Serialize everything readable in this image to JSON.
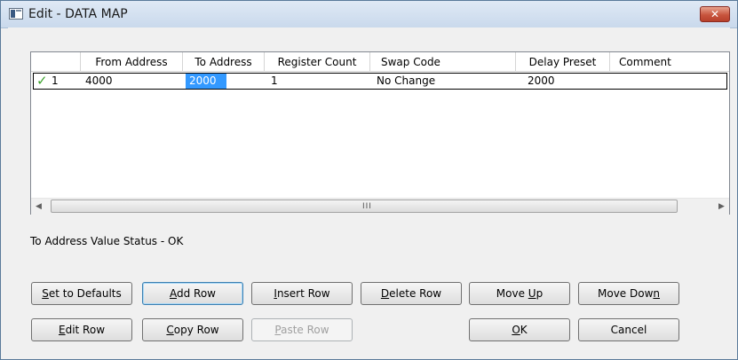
{
  "window": {
    "title": "Edit - DATA MAP",
    "close_label": "✕"
  },
  "table": {
    "columns": [
      "From Address",
      "To Address",
      "Register Count",
      "Swap Code",
      "Delay Preset",
      "Comment"
    ],
    "rows": [
      {
        "number": "1",
        "status": "valid",
        "from_address": "4000",
        "to_address": "2000",
        "register_count": "1",
        "swap_code": "No Change",
        "delay_preset": "2000",
        "comment": ""
      }
    ],
    "selected_cell": "to_address"
  },
  "scrollbar": {
    "left_arrow": "◀",
    "right_arrow": "▶",
    "grip": "III"
  },
  "status_text": "To Address Value Status - OK",
  "buttons": {
    "set_to_defaults": {
      "pre": "",
      "key": "S",
      "post": "et to Defaults"
    },
    "add_row": {
      "pre": "",
      "key": "A",
      "post": "dd Row"
    },
    "insert_row": {
      "pre": "",
      "key": "I",
      "post": "nsert Row"
    },
    "delete_row": {
      "pre": "",
      "key": "D",
      "post": "elete Row"
    },
    "move_up": {
      "pre": "Move ",
      "key": "U",
      "post": "p"
    },
    "move_down": {
      "pre": "Move Dow",
      "key": "n",
      "post": ""
    },
    "edit_row": {
      "pre": "",
      "key": "E",
      "post": "dit Row"
    },
    "copy_row": {
      "pre": "",
      "key": "C",
      "post": "opy Row"
    },
    "paste_row": {
      "pre": "",
      "key": "P",
      "post": "aste Row",
      "disabled": true
    },
    "ok": {
      "pre": "",
      "key": "O",
      "post": "K"
    },
    "cancel": {
      "pre": "Cancel",
      "key": "",
      "post": ""
    }
  }
}
